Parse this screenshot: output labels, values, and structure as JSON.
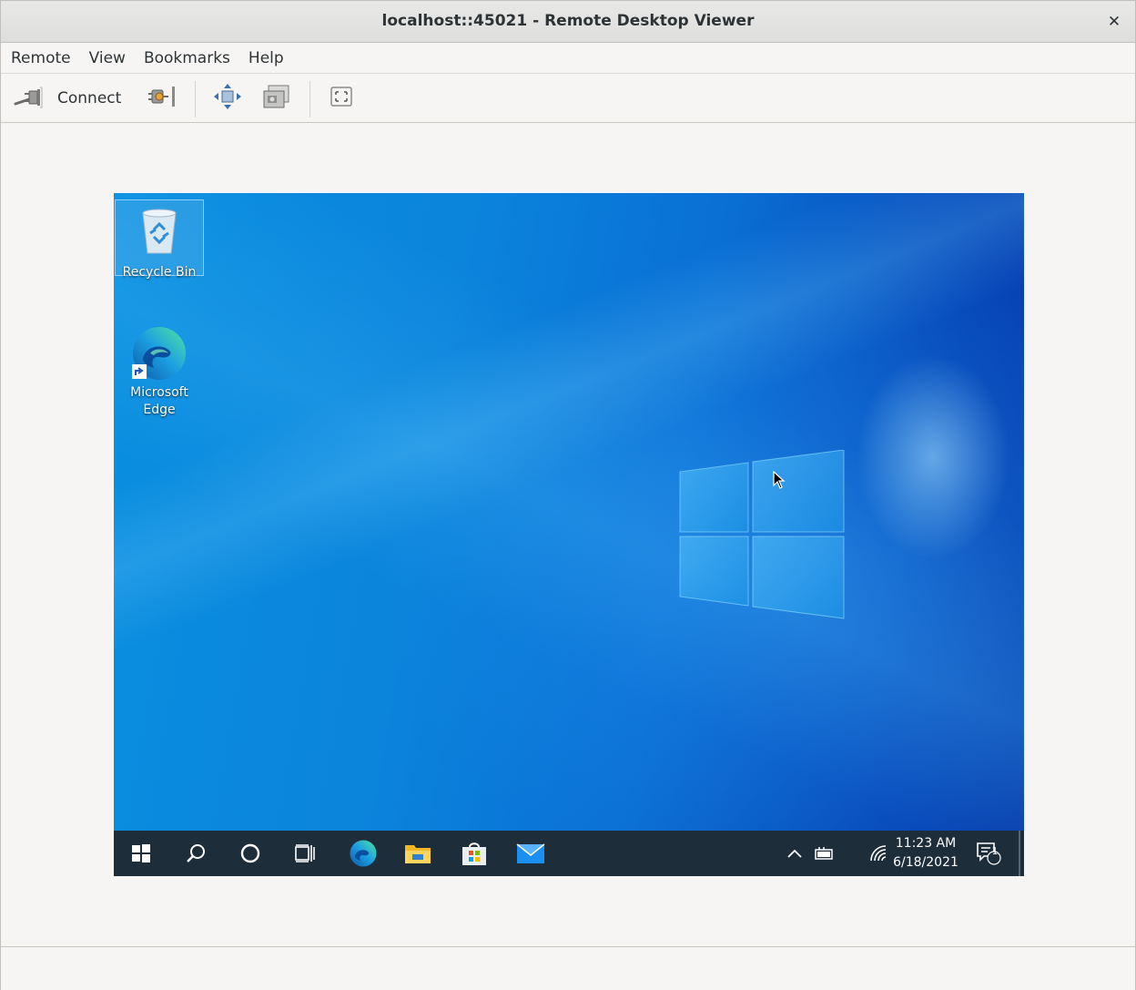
{
  "window": {
    "title": "localhost::45021 - Remote Desktop Viewer",
    "close_glyph": "✕"
  },
  "menubar": {
    "items": [
      "Remote",
      "View",
      "Bookmarks",
      "Help"
    ]
  },
  "toolbar": {
    "connect_label": "Connect",
    "icons": [
      "connect-plug-icon",
      "disconnect-plug-icon",
      "fit-window-icon",
      "screenshot-icon",
      "fullscreen-icon"
    ]
  },
  "remote_desktop": {
    "desktop_icons": [
      {
        "label": "Recycle Bin",
        "icon": "recycle-bin-icon",
        "selected": true
      },
      {
        "label": "Microsoft Edge",
        "icon": "edge-icon",
        "selected": false
      }
    ],
    "taskbar": {
      "pinned": [
        "start-icon",
        "search-icon",
        "cortana-icon",
        "task-view-icon",
        "edge-icon",
        "file-explorer-icon",
        "store-icon",
        "mail-icon"
      ],
      "tray": [
        "chevron-up-icon",
        "battery-icon",
        "network-icon"
      ],
      "clock": {
        "time": "11:23 AM",
        "date": "6/18/2021"
      },
      "notifications_count": "1"
    },
    "colors": {
      "wallpaper_light": "#0a8fe0",
      "wallpaper_dark": "#0538a8",
      "taskbar": "#1e2d3a"
    }
  }
}
